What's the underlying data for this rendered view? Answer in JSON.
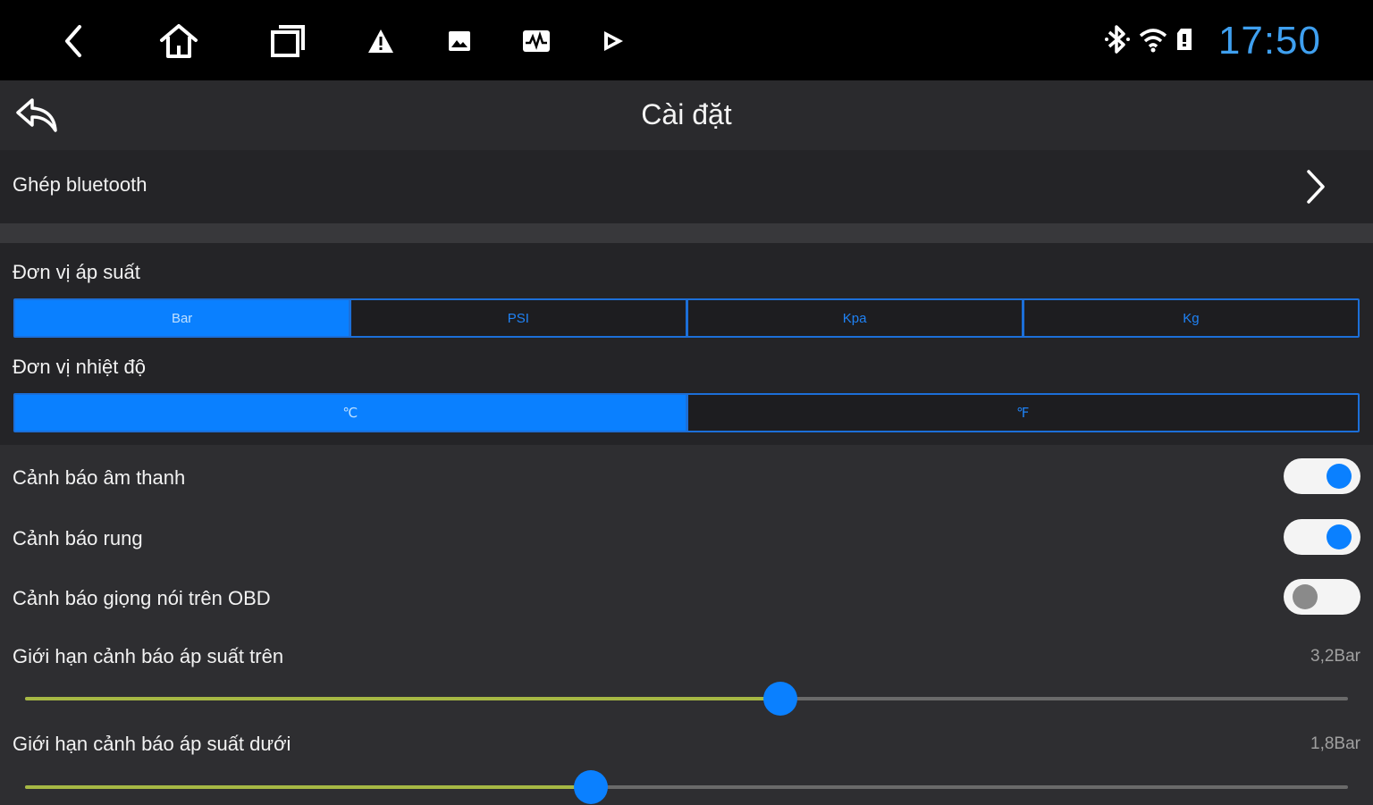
{
  "status_bar": {
    "icons": [
      "back-icon",
      "home-icon",
      "recent-apps-icon",
      "warning-icon",
      "image-icon",
      "waveform-icon",
      "play-icon"
    ],
    "right_icons": [
      "bluetooth-icon",
      "wifi-icon",
      "sd-card-icon"
    ],
    "clock": "17:50"
  },
  "header": {
    "title": "Cài đặt"
  },
  "bluetooth_row": {
    "label": "Ghép bluetooth"
  },
  "pressure_unit": {
    "label": "Đơn vị áp suất",
    "options": [
      "Bar",
      "PSI",
      "Kpa",
      "Kg"
    ],
    "selected": "Bar"
  },
  "temperature_unit": {
    "label": "Đơn vị nhiệt độ",
    "options": [
      "℃",
      "℉"
    ],
    "selected": "℃"
  },
  "toggles": [
    {
      "label": "Cảnh báo âm thanh",
      "on": true
    },
    {
      "label": "Cảnh báo rung",
      "on": true
    },
    {
      "label": "Cảnh báo giọng nói trên OBD",
      "on": false
    }
  ],
  "sliders": [
    {
      "label": "Giới hạn cảnh báo áp suất trên",
      "value_text": "3,2Bar",
      "fraction": 0.571
    },
    {
      "label": "Giới hạn cảnh báo áp suất dưới",
      "value_text": "1,8Bar",
      "fraction": 0.428
    }
  ],
  "colors": {
    "accent": "#0a80ff",
    "clock": "#3fa0f0",
    "slider_fill": "#a6b844"
  }
}
